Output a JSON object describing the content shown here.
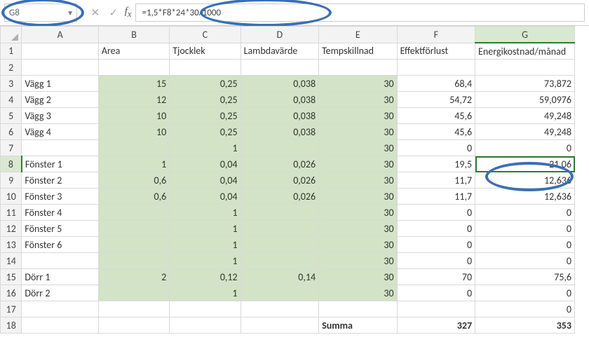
{
  "name_box": "G8",
  "formula": "=1,5*F8*24*30/1000",
  "columns": [
    "A",
    "B",
    "C",
    "D",
    "E",
    "F",
    "G"
  ],
  "headers": {
    "B": "Area",
    "C": "Tjocklek",
    "D": "Lambdavärde",
    "E": "Tempskillnad",
    "F": "Effektförlust",
    "G": "Energikostnad/månad"
  },
  "selected_rc": {
    "row": 8,
    "col": "G"
  },
  "summa_label": "Summa",
  "col_widths": {
    "rh": 30,
    "A": 108,
    "B": 100,
    "C": 100,
    "D": 110,
    "E": 110,
    "F": 110,
    "G": 140
  },
  "rows": [
    {
      "n": 1
    },
    {
      "n": 2
    },
    {
      "n": 3,
      "A": "Vägg 1",
      "B": "15",
      "C": "0,25",
      "D": "0,038",
      "E": "30",
      "F": "68,4",
      "G": "73,872"
    },
    {
      "n": 4,
      "A": "Vägg 2",
      "B": "12",
      "C": "0,25",
      "D": "0,038",
      "E": "30",
      "F": "54,72",
      "G": "59,0976"
    },
    {
      "n": 5,
      "A": "Vägg 3",
      "B": "10",
      "C": "0,25",
      "D": "0,038",
      "E": "30",
      "F": "45,6",
      "G": "49,248"
    },
    {
      "n": 6,
      "A": "Vägg 4",
      "B": "10",
      "C": "0,25",
      "D": "0,038",
      "E": "30",
      "F": "45,6",
      "G": "49,248"
    },
    {
      "n": 7,
      "A": "",
      "B": "",
      "C": "1",
      "D": "",
      "E": "30",
      "F": "0",
      "G": "0"
    },
    {
      "n": 8,
      "A": "Fönster 1",
      "B": "1",
      "C": "0,04",
      "D": "0,026",
      "E": "30",
      "F": "19,5",
      "G": "21,06"
    },
    {
      "n": 9,
      "A": "Fönster 2",
      "B": "0,6",
      "C": "0,04",
      "D": "0,026",
      "E": "30",
      "F": "11,7",
      "G": "12,636"
    },
    {
      "n": 10,
      "A": "Fönster 3",
      "B": "0,6",
      "C": "0,04",
      "D": "0,026",
      "E": "30",
      "F": "11,7",
      "G": "12,636"
    },
    {
      "n": 11,
      "A": "Fönster 4",
      "B": "",
      "C": "1",
      "D": "",
      "E": "30",
      "F": "0",
      "G": "0"
    },
    {
      "n": 12,
      "A": "Fönster 5",
      "B": "",
      "C": "1",
      "D": "",
      "E": "30",
      "F": "0",
      "G": "0"
    },
    {
      "n": 13,
      "A": "Fönster 6",
      "B": "",
      "C": "1",
      "D": "",
      "E": "30",
      "F": "0",
      "G": "0"
    },
    {
      "n": 14,
      "A": "",
      "B": "",
      "C": "1",
      "D": "",
      "E": "30",
      "F": "0",
      "G": "0"
    },
    {
      "n": 15,
      "A": "Dörr 1",
      "B": "2",
      "C": "0,12",
      "D": "0,14",
      "E": "30",
      "F": "70",
      "G": "75,6"
    },
    {
      "n": 16,
      "A": "Dörr 2",
      "B": "",
      "C": "1",
      "D": "",
      "E": "30",
      "F": "0",
      "G": "0"
    },
    {
      "n": 17,
      "A": "",
      "G": "0"
    },
    {
      "n": 18,
      "E": "Summa",
      "F": "327",
      "G": "353",
      "bold": true
    }
  ]
}
